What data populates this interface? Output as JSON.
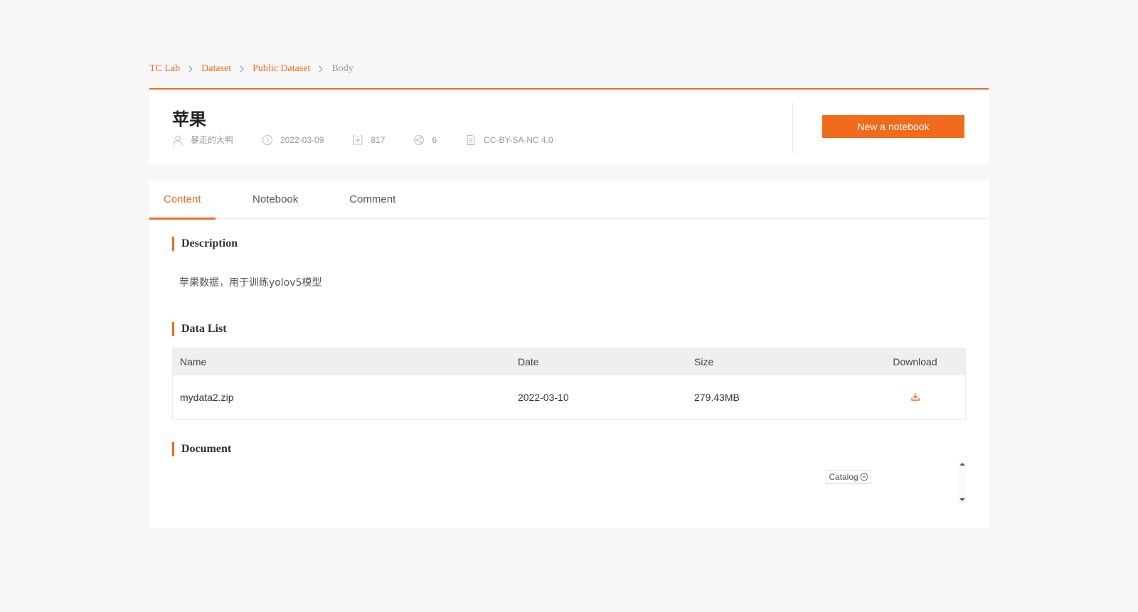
{
  "breadcrumb": {
    "items": [
      {
        "label": "TC Lab"
      },
      {
        "label": "Dataset"
      },
      {
        "label": "Public Dataset"
      }
    ],
    "current": "Body"
  },
  "dataset": {
    "title": "苹果",
    "author": "暴走的大鸭",
    "date": "2022-03-09",
    "downloads": "817",
    "shares": "6",
    "license": "CC-BY-SA-NC 4.0"
  },
  "actions": {
    "new_notebook_label": "New a notebook"
  },
  "tabs": [
    {
      "label": "Content",
      "active": true
    },
    {
      "label": "Notebook",
      "active": false
    },
    {
      "label": "Comment",
      "active": false
    }
  ],
  "sections": {
    "description_title": "Description",
    "description_text": "苹果数据，用于训练yolov5模型",
    "data_list_title": "Data List",
    "document_title": "Document"
  },
  "table": {
    "headers": {
      "name": "Name",
      "date": "Date",
      "size": "Size",
      "download": "Download"
    },
    "rows": [
      {
        "name": "mydata2.zip",
        "date": "2022-03-10",
        "size": "279.43MB"
      }
    ]
  },
  "document": {
    "catalog_label": "Catalog"
  },
  "colors": {
    "accent": "#f26b1d",
    "background": "#f7f7f7"
  },
  "icons": {
    "author": "user-icon",
    "date": "clock-icon",
    "downloads": "download-icon",
    "shares": "share-icon",
    "license": "document-icon"
  }
}
